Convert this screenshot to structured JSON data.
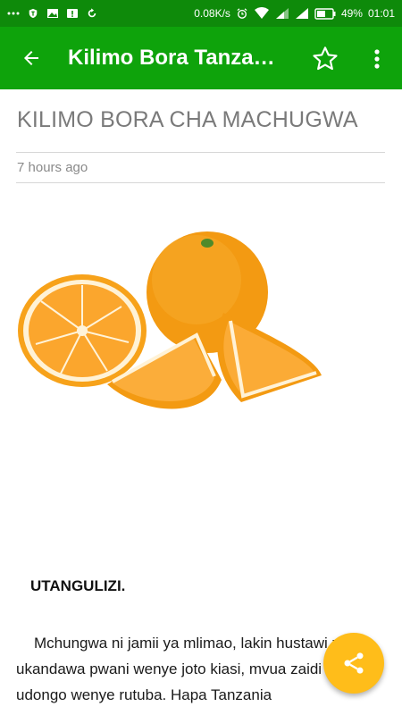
{
  "status_bar": {
    "network_speed": "0.08K/s",
    "battery": "49%",
    "time": "01:01",
    "left_icons": [
      "dots-icon",
      "shield-icon",
      "image-icon",
      "alert-icon",
      "sync-icon"
    ],
    "right_icons": [
      "alarm-icon",
      "wifi-icon",
      "signal-icon",
      "signal-icon",
      "battery-icon"
    ]
  },
  "app_bar": {
    "title": "Kilimo Bora Tanzania",
    "back_icon": "arrow-left-icon",
    "star_icon": "star-outline-icon",
    "menu_icon": "more-vert-icon",
    "color": "#0ea30b"
  },
  "article": {
    "title": "KILIMO BORA CHA MACHUGWA",
    "timestamp": "7 hours ago",
    "image": "oranges-image",
    "section_heading": "UTANGULIZI.",
    "paragraph": "Mchungwa ni jamii ya mlimao, lakin hustawi zaidi ukandawa pwani wenye joto kiasi, mvua zaidi na udongo wenye rutuba. Hapa Tanzania"
  },
  "fab": {
    "icon": "share-icon",
    "color": "#ffbd1a"
  }
}
